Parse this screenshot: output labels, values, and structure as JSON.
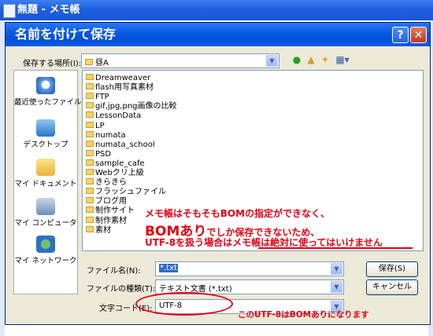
{
  "background_window": {
    "title": "無題 - メモ帳"
  },
  "dialog": {
    "title": "名前を付けて保存",
    "help_label": "?",
    "close_label": "✕",
    "save_in_label": "保存する場所(I):",
    "save_in_value": "昼A",
    "toolbar_icons": [
      "back-icon",
      "up-folder-icon",
      "new-folder-icon",
      "views-menu-icon"
    ],
    "places": [
      {
        "label": "最近使ったファイル",
        "icon": "recent-documents-icon"
      },
      {
        "label": "デスクトップ",
        "icon": "desktop-icon"
      },
      {
        "label": "マイ ドキュメント",
        "icon": "my-documents-icon"
      },
      {
        "label": "マイ コンピュータ",
        "icon": "my-computer-icon"
      },
      {
        "label": "マイ ネットワーク",
        "icon": "my-network-icon"
      }
    ],
    "files": [
      "Dreamweaver",
      "flash用写真素材",
      "FTP",
      "gif,jpg,png画像の比較",
      "LessonData",
      "LP",
      "numata",
      "numata_school",
      "PSD",
      "sample_cafe",
      "Webクリ上級",
      "きらきら",
      "フラッシュファイル",
      "ブログ用",
      "制作サイト",
      "制作素材",
      "素材"
    ],
    "filename_label": "ファイル名(N):",
    "filename_value": "*.txt",
    "filetype_label": "ファイルの種類(T):",
    "filetype_value": "テキスト文書 (*.txt)",
    "encoding_label": "文字コード(E):",
    "encoding_value": "UTF-8",
    "save_button": "保存(S)",
    "cancel_button": "キャンセル"
  },
  "annotations": {
    "line1": "メモ帳はそもそもBOMの指定ができなく、",
    "line2_big": "BOMあり",
    "line2_rest": "でしか保存できないため、",
    "line3_a": "UTF-8を扱う場合は",
    "line3_b": "メモ帳は絶対に使ってはいけません",
    "encoding_note": "このUTF-8はBOMありになります",
    "color": "#e60012"
  }
}
